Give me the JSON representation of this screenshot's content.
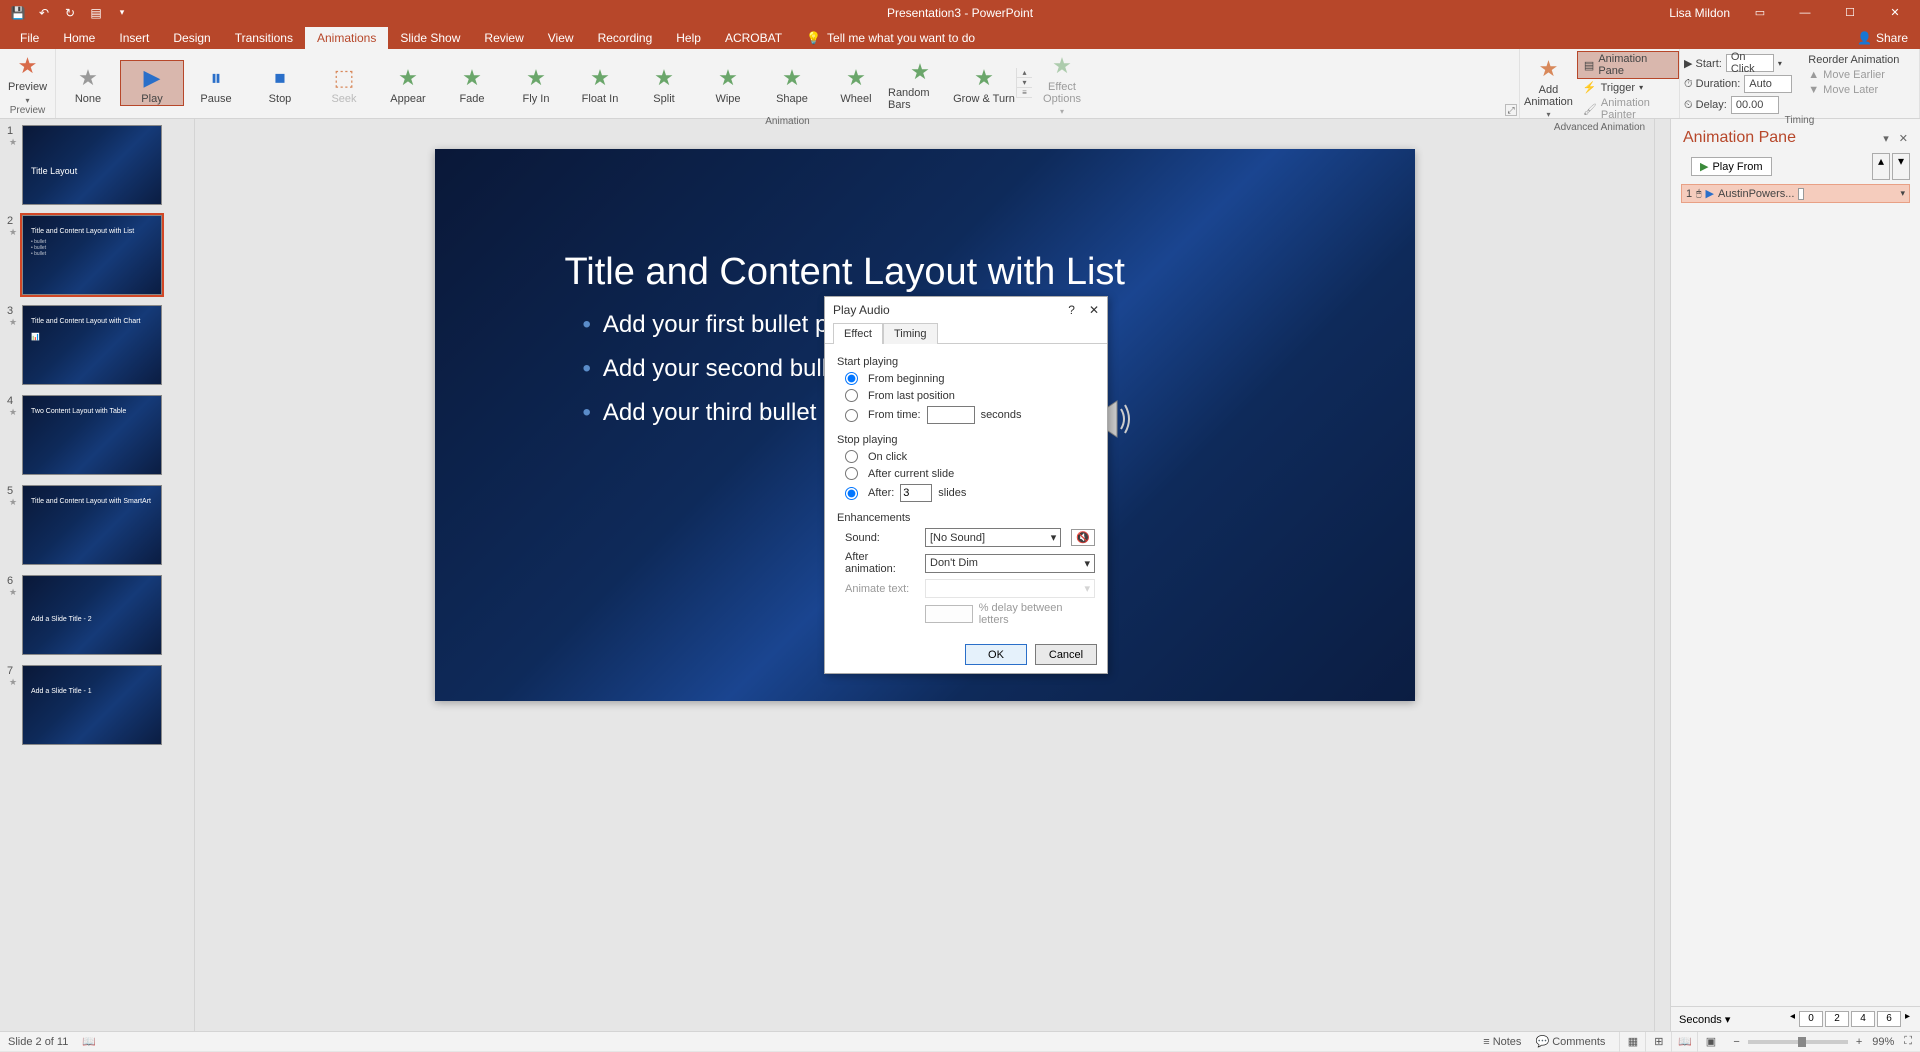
{
  "app": {
    "title": "Presentation3 - PowerPoint",
    "user": "Lisa Mildon"
  },
  "tabs": [
    "File",
    "Home",
    "Insert",
    "Design",
    "Transitions",
    "Animations",
    "Slide Show",
    "Review",
    "View",
    "Recording",
    "Help",
    "ACROBAT"
  ],
  "active_tab": "Animations",
  "tell_me": "Tell me what you want to do",
  "share": "Share",
  "ribbon": {
    "preview": {
      "label": "Preview",
      "group": "Preview"
    },
    "animation_gallery": [
      "None",
      "Play",
      "Pause",
      "Stop",
      "Seek",
      "Appear",
      "Fade",
      "Fly In",
      "Float In",
      "Split",
      "Wipe",
      "Shape",
      "Wheel",
      "Random Bars",
      "Grow & Turn"
    ],
    "animation_group": "Animation",
    "effect_options": "Effect\nOptions",
    "add_animation": "Add\nAnimation",
    "anim_pane_btn": "Animation Pane",
    "trigger_btn": "Trigger",
    "painter_btn": "Animation Painter",
    "adv_group": "Advanced Animation",
    "timing": {
      "start_lbl": "Start:",
      "start_val": "On Click",
      "duration_lbl": "Duration:",
      "duration_val": "Auto",
      "delay_lbl": "Delay:",
      "delay_val": "00.00",
      "reorder": "Reorder Animation",
      "earlier": "Move Earlier",
      "later": "Move Later",
      "group": "Timing"
    }
  },
  "thumbs": [
    {
      "n": 1,
      "title": "Title Layout"
    },
    {
      "n": 2,
      "title": "Title and Content Layout with List"
    },
    {
      "n": 3,
      "title": "Title and Content Layout with Chart"
    },
    {
      "n": 4,
      "title": "Two Content Layout with Table"
    },
    {
      "n": 5,
      "title": "Title and Content Layout with SmartArt"
    },
    {
      "n": 6,
      "title": "Add a Slide Title - 2"
    },
    {
      "n": 7,
      "title": "Add a Slide Title - 1"
    }
  ],
  "selected_thumb": 2,
  "slide": {
    "title": "Title and Content Layout with List",
    "b1": "Add your first bullet point here",
    "b2": "Add your second bullet point here",
    "b3": "Add your third bullet point here"
  },
  "dialog": {
    "title": "Play Audio",
    "tab_effect": "Effect",
    "tab_timing": "Timing",
    "start_playing": "Start playing",
    "from_beginning": "From beginning",
    "from_last": "From last position",
    "from_time": "From time:",
    "seconds": "seconds",
    "stop_playing": "Stop playing",
    "on_click": "On click",
    "after_current": "After current slide",
    "after_lbl": "After:",
    "after_val": "3",
    "slides": "slides",
    "enhancements": "Enhancements",
    "sound_lbl": "Sound:",
    "sound_val": "[No Sound]",
    "after_anim_lbl": "After animation:",
    "after_anim_val": "Don't Dim",
    "animate_text_lbl": "Animate text:",
    "delay_letters": "% delay between letters",
    "ok": "OK",
    "cancel": "Cancel"
  },
  "anim_pane": {
    "title": "Animation Pane",
    "play_from": "Play From",
    "item_num": "1",
    "item_name": "AustinPowers...",
    "seconds_lbl": "Seconds",
    "ticks": [
      "0",
      "2",
      "4",
      "6"
    ]
  },
  "status": {
    "slide": "Slide 2 of 11",
    "notes": "Notes",
    "comments": "Comments",
    "zoom": "99%"
  }
}
